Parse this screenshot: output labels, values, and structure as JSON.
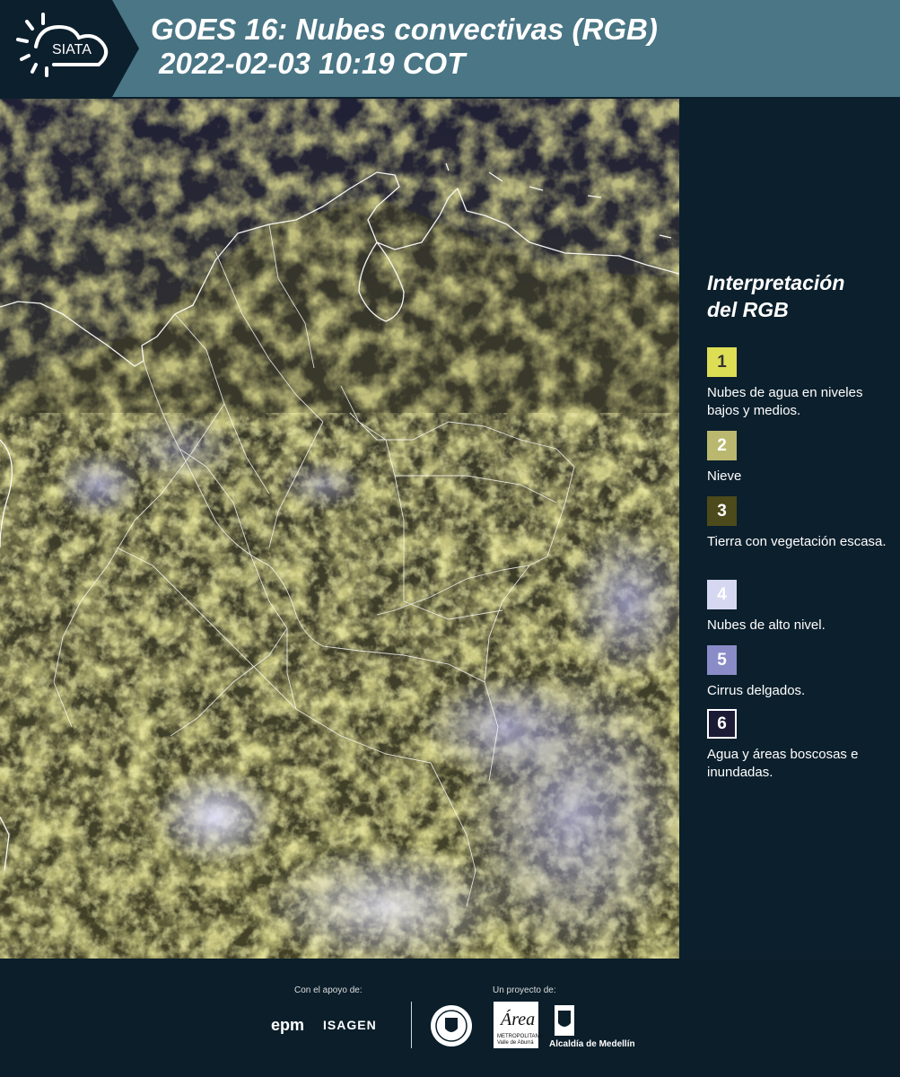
{
  "header": {
    "logo_text": "SIATA",
    "title_line1": "GOES 16: Nubes convectivas (RGB)",
    "title_line2": " 2022-02-03 10:19 COT"
  },
  "legend": {
    "title_line1": "Interpretación",
    "title_line2": "del RGB",
    "items": [
      {
        "number": "1",
        "label": "Nubes de agua en niveles bajos y medios.",
        "color": "#dede55",
        "text_color": "#333"
      },
      {
        "number": "2",
        "label": "Nieve",
        "color": "#b9b86e",
        "text_color": "#fff"
      },
      {
        "number": "3",
        "label": "Tierra con vegetación escasa.",
        "color": "#4d4a1b",
        "text_color": "#fff"
      },
      {
        "number": "4",
        "label": "Nubes de alto nivel.",
        "color": "#d6d8f2",
        "text_color": "#fff"
      },
      {
        "number": "5",
        "label": "Cirrus delgados.",
        "color": "#8a8cc8",
        "text_color": "#fff"
      },
      {
        "number": "6",
        "label": "Agua y áreas boscosas e inundadas.",
        "color": "#1c1b35",
        "text_color": "#fff"
      }
    ]
  },
  "footer": {
    "support_label": "Con el apoyo de:",
    "project_label": "Un proyecto de:",
    "sponsor_1": "epm",
    "sponsor_2": "ISAGEN",
    "partner_1_text": "METROPOLITANA Valle de Aburrá",
    "partner_2": "Alcaldía de Medellín"
  }
}
